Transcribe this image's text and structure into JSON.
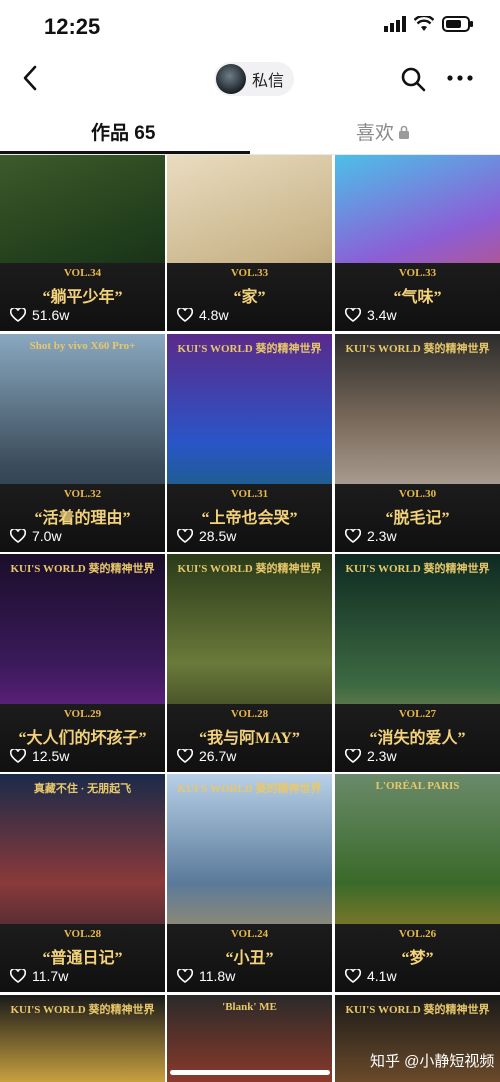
{
  "status": {
    "time": "12:25"
  },
  "nav": {
    "title": "私信"
  },
  "tabs": {
    "works": "作品 65",
    "likes": "喜欢"
  },
  "grid": [
    {
      "vol": "VOL.34",
      "title": "“躺平少年”",
      "likes": "51.6w",
      "header": ""
    },
    {
      "vol": "VOL.33",
      "title": "“家”",
      "likes": "4.8w",
      "header": ""
    },
    {
      "vol": "VOL.33",
      "title": "“气味”",
      "likes": "3.4w",
      "header": ""
    },
    {
      "vol": "VOL.32",
      "title": "“活着的理由”",
      "likes": "7.0w",
      "header": "Shot by vivo X60 Pro+"
    },
    {
      "vol": "VOL.31",
      "title": "“上帝也会哭”",
      "likes": "28.5w",
      "header": "KUI'S WORLD 葵的精神世界"
    },
    {
      "vol": "VOL.30",
      "title": "“脱毛记”",
      "likes": "2.3w",
      "header": "KUI'S WORLD 葵的精神世界"
    },
    {
      "vol": "VOL.29",
      "title": "“大人们的坏孩子”",
      "likes": "12.5w",
      "header": "KUI'S WORLD 葵的精神世界"
    },
    {
      "vol": "VOL.28",
      "title": "“我与阿MAY”",
      "likes": "26.7w",
      "header": "KUI'S WORLD 葵的精神世界"
    },
    {
      "vol": "VOL.27",
      "title": "“消失的爱人”",
      "likes": "2.3w",
      "header": "KUI'S WORLD 葵的精神世界"
    },
    {
      "vol": "VOL.28",
      "title": "“普通日记”",
      "likes": "11.7w",
      "header": "真藏不住 · 无朋起飞"
    },
    {
      "vol": "VOL.24",
      "title": "“小丑”",
      "likes": "11.8w",
      "header": "KUI'S WORLD 葵的精神世界"
    },
    {
      "vol": "VOL.26",
      "title": "“梦”",
      "likes": "4.1w",
      "header": "L'ORÉAL PARIS"
    },
    {
      "vol": "",
      "title": "",
      "likes": "",
      "header": "KUI'S WORLD 葵的精神世界"
    },
    {
      "vol": "",
      "title": "",
      "likes": "",
      "header": "'Blank' ME"
    },
    {
      "vol": "",
      "title": "",
      "likes": "",
      "header": "KUI'S WORLD 葵的精神世界"
    }
  ],
  "watermark": "知乎 @小静短视频"
}
